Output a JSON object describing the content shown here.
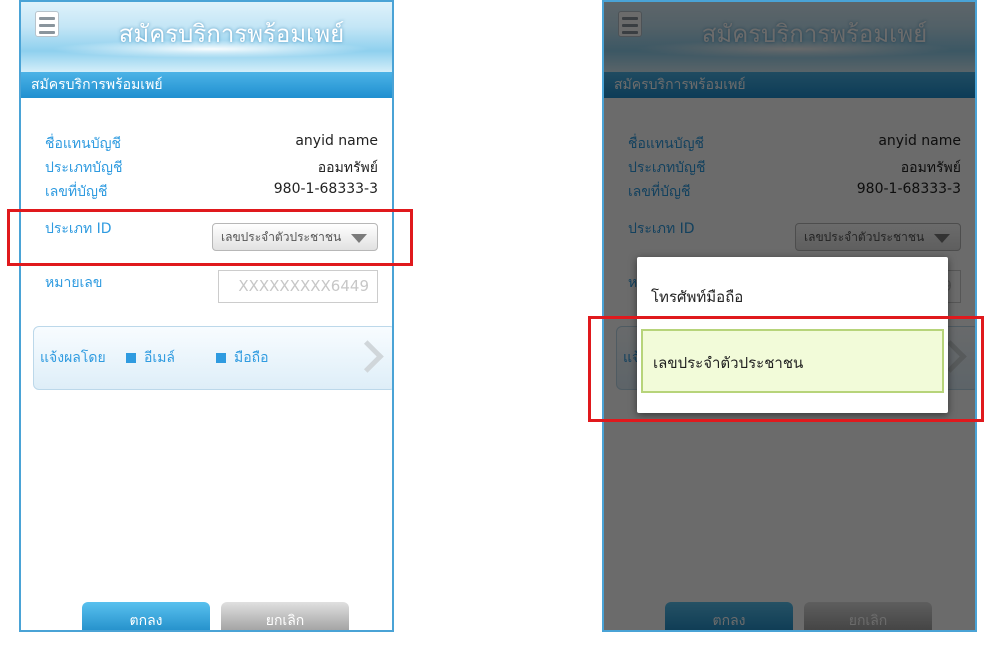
{
  "app_title": "สมัครบริการพร้อมเพย์",
  "section_title": "สมัครบริการพร้อมเพย์",
  "fields": {
    "account_name": {
      "label": "ชื่อแทนบัญชี",
      "value": "anyid name"
    },
    "account_type": {
      "label": "ประเภทบัญชี",
      "value": "ออมทรัพย์"
    },
    "account_number": {
      "label": "เลขที่บัญชี",
      "value": "980-1-68333-3"
    },
    "id_type": {
      "label": "ประเภท ID",
      "selected": "เลขประจำตัวประชาชน"
    },
    "id_number": {
      "label": "หมายเลข",
      "value": "XXXXXXXXX6449"
    }
  },
  "notify": {
    "label": "แจ้งผลโดย",
    "options": [
      "อีเมล์",
      "มือถือ"
    ]
  },
  "buttons": {
    "ok": "ตกลง",
    "cancel": "ยกเลิก"
  },
  "dropdown_options": [
    "โทรศัพท์มือถือ",
    "เลขประจำตัวประชาชน"
  ],
  "colors": {
    "accent": "#2f9be0",
    "highlight": "#e0191d",
    "selected_option_bg": "#f2fbd9"
  }
}
